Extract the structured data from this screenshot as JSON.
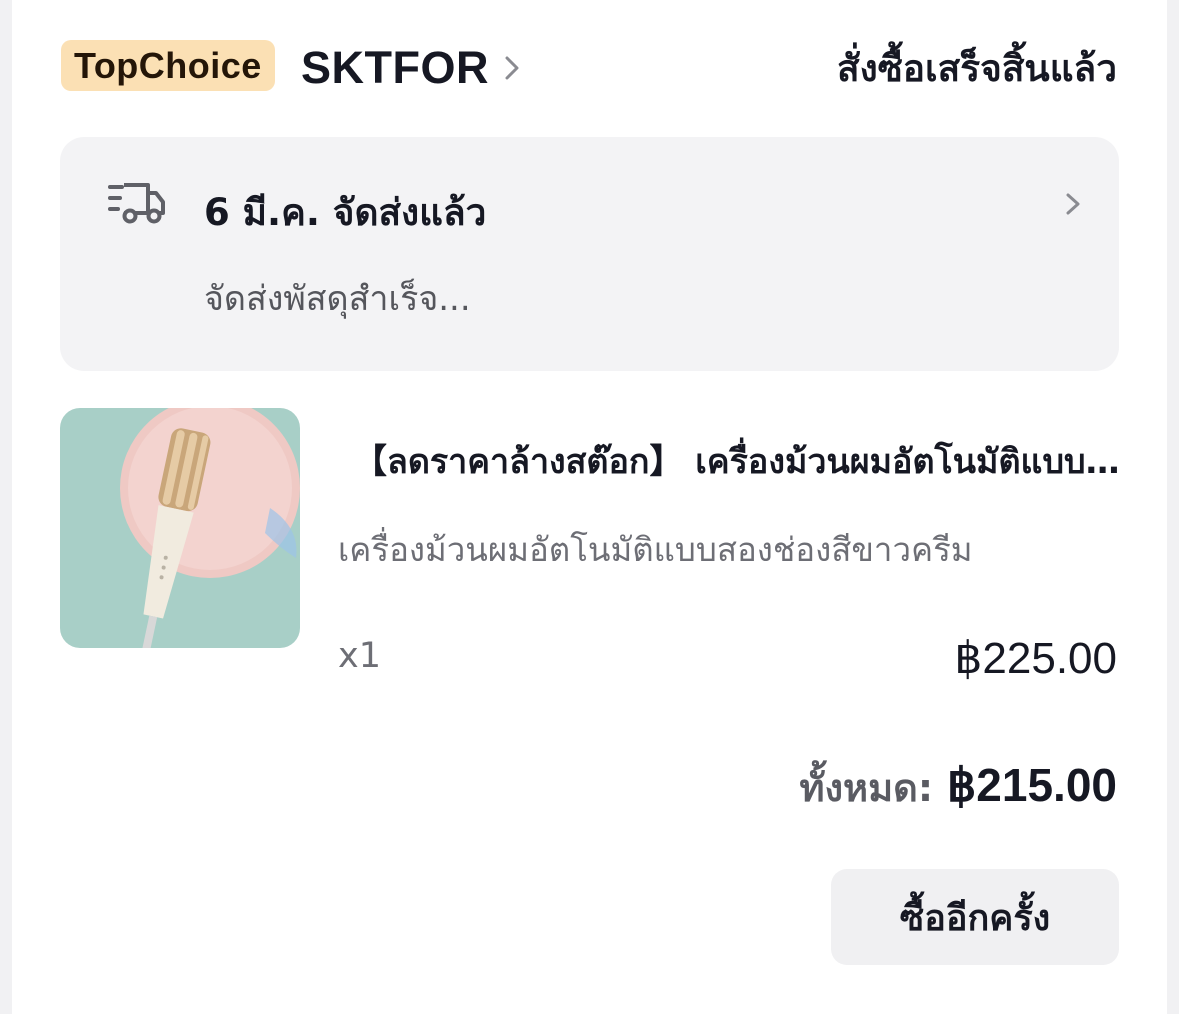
{
  "header": {
    "badge": "TopChoice",
    "shop_name": "SKTFOR",
    "order_status": "สั่งซื้อเสร็จสิ้นแล้ว"
  },
  "shipping": {
    "title": "6 มี.ค. จัดส่งแล้ว",
    "subtitle": "จัดส่งพัสดุสำเร็จ..."
  },
  "product": {
    "title": "【ลดราคาล้างสต๊อก】 เครื่องม้วนผมอัตโนมัติแบบสองช่องสีขาวครีม",
    "variant": "เครื่องม้วนผมอัตโนมัติแบบสองช่องสีขาวครีม",
    "quantity": "x1",
    "price": "฿225.00"
  },
  "summary": {
    "total_label": "ทั้งหมด:",
    "total_value": "฿215.00"
  },
  "actions": {
    "buy_again": "ซื้ออีกครั้ง"
  },
  "icons": {
    "shop_chevron": "chevron-right-icon",
    "truck": "delivery-truck-icon",
    "ship_chevron": "chevron-right-icon"
  },
  "colors": {
    "badge_bg": "#fbe0b4",
    "panel_bg": "#f3f3f5",
    "text_primary": "#161823",
    "text_secondary": "#6d6e75"
  }
}
